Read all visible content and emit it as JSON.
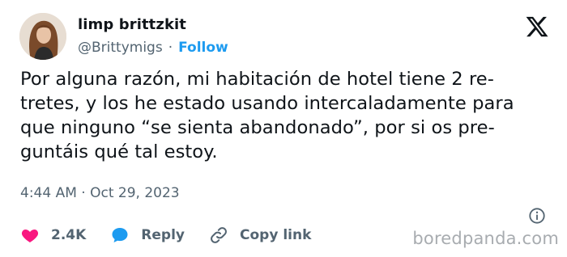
{
  "author": {
    "name": "limp brittzkit",
    "handle": "@Brittymigs",
    "separator": "·",
    "follow_label": "Follow"
  },
  "tweet": {
    "lines": [
      "Por alguna razón, mi habitación de hotel tiene 2 re-",
      "tretes, y los he estado usando intercaladamente para",
      "que ninguno “se sienta abandonado”, por si os pre-",
      "guntáis qué tal estoy."
    ]
  },
  "timestamp": "4:44 AM · Oct 29, 2023",
  "actions": {
    "likes": "2.4K",
    "reply_label": "Reply",
    "copy_link_label": "Copy link"
  },
  "icons": {
    "like": "heart-icon",
    "reply": "speech-bubble-icon",
    "copy": "link-icon",
    "info": "info-icon",
    "brand": "x-logo-icon"
  },
  "colors": {
    "accent": "#1d9bf0",
    "like": "#f91880",
    "muted": "#536471",
    "text": "#0f1419"
  },
  "watermark": "boredpanda.com"
}
